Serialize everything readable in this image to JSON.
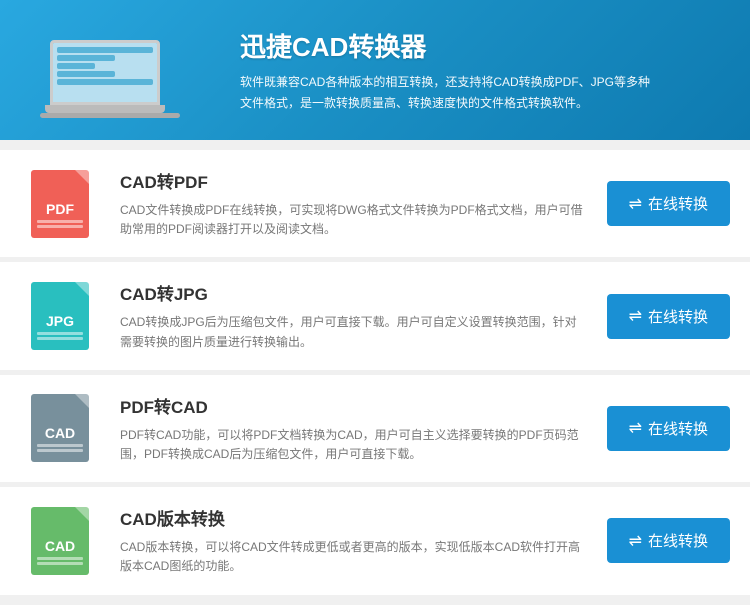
{
  "header": {
    "title": "迅捷CAD转换器",
    "description": "软件既兼容CAD各种版本的相互转换，还支持将CAD转换成PDF、JPG等多种文件格式，是一款转换质量高、转换速度快的文件格式转换软件。"
  },
  "items": [
    {
      "id": "cad-to-pdf",
      "icon_type": "pdf",
      "icon_label": "PDF",
      "title": "CAD转PDF",
      "description": "CAD文件转换成PDF在线转换，可实现将DWG格式文件转换为PDF格式文档，用户可借助常用的PDF阅读器打开以及阅读文档。",
      "button_label": "在线转换"
    },
    {
      "id": "cad-to-jpg",
      "icon_type": "jpg",
      "icon_label": "JPG",
      "title": "CAD转JPG",
      "description": "CAD转换成JPG后为压缩包文件，用户可直接下载。用户可自定义设置转换范围，针对需要转换的图片质量进行转换输出。",
      "button_label": "在线转换"
    },
    {
      "id": "pdf-to-cad",
      "icon_type": "cad-gray",
      "icon_label": "CAD",
      "title": "PDF转CAD",
      "description": "PDF转CAD功能，可以将PDF文档转换为CAD，用户可自主义选择要转换的PDF页码范围，PDF转换成CAD后为压缩包文件，用户可直接下载。",
      "button_label": "在线转换"
    },
    {
      "id": "cad-version",
      "icon_type": "cad-green",
      "icon_label": "CAD",
      "title": "CAD版本转换",
      "description": "CAD版本转换，可以将CAD文件转成更低或者更高的版本，实现低版本CAD软件打开高版本CAD图纸的功能。",
      "button_label": "在线转换"
    }
  ]
}
